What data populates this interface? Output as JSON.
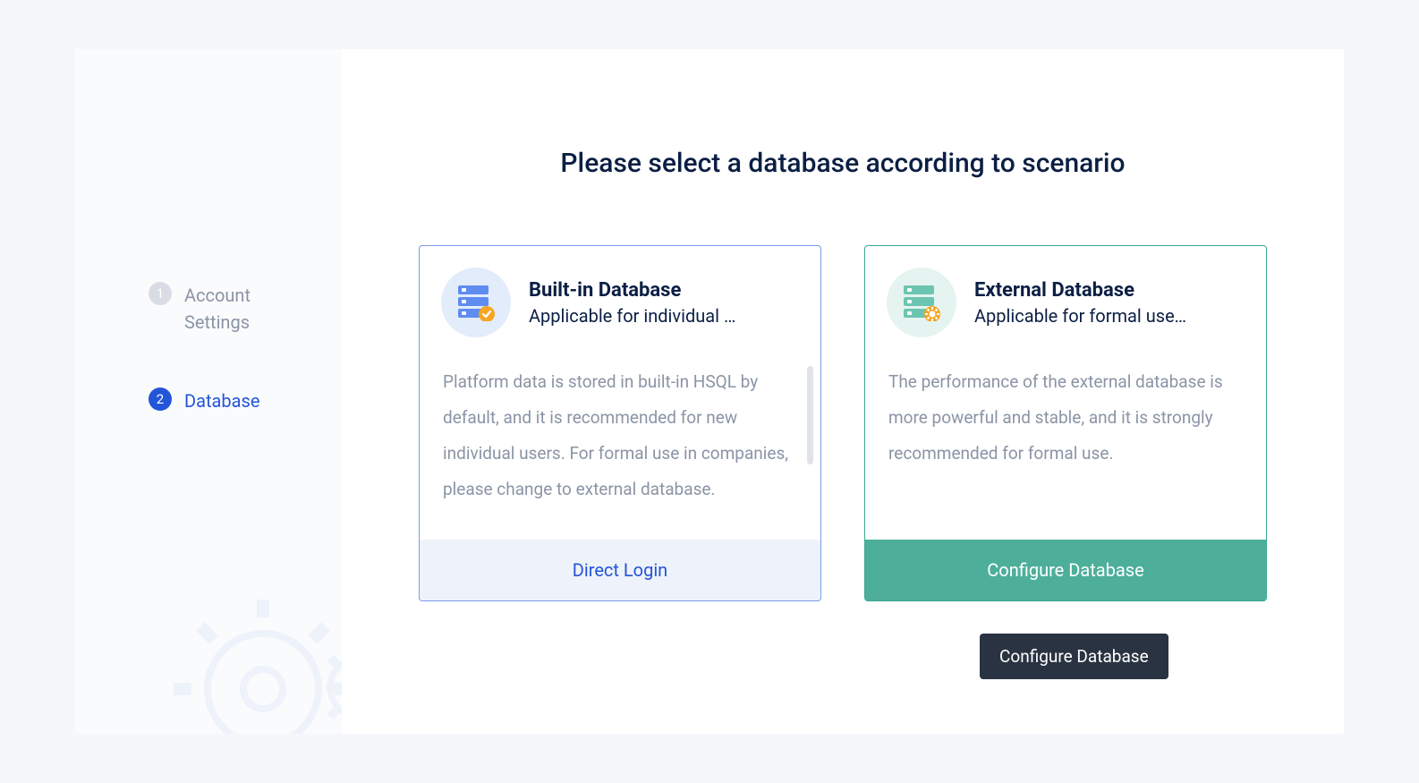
{
  "sidebar": {
    "steps": [
      {
        "num": "1",
        "label": "Account Settings",
        "active": false
      },
      {
        "num": "2",
        "label": "Database",
        "active": true
      }
    ]
  },
  "page": {
    "title": "Please select a database according to scenario"
  },
  "cards": {
    "builtin": {
      "title": "Built-in Database",
      "subtitle": "Applicable for individual …",
      "body": "Platform data is stored in built-in HSQL by default, and it is recommended for new individual users. For formal use in companies, please change to external database.",
      "action": "Direct Login"
    },
    "external": {
      "title": "External Database",
      "subtitle": "Applicable for formal use…",
      "body": "The performance of the external database is more powerful and stable, and it is strongly recommended for formal use.",
      "action": "Configure Database"
    }
  },
  "tooltip": {
    "text": "Configure Database"
  }
}
